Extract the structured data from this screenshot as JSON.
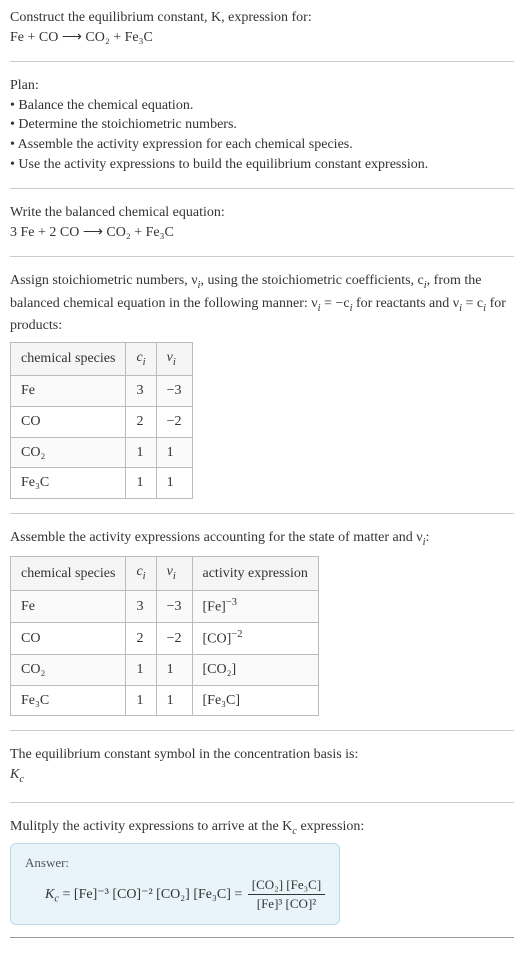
{
  "intro": {
    "line1": "Construct the equilibrium constant, K, expression for:",
    "equation": "Fe + CO ⟶ CO₂ + Fe₃C"
  },
  "plan": {
    "heading": "Plan:",
    "items": [
      "Balance the chemical equation.",
      "Determine the stoichiometric numbers.",
      "Assemble the activity expression for each chemical species.",
      "Use the activity expressions to build the equilibrium constant expression."
    ]
  },
  "balanced": {
    "heading": "Write the balanced chemical equation:",
    "equation": "3 Fe + 2 CO ⟶ CO₂ + Fe₃C"
  },
  "assign": {
    "text1": "Assign stoichiometric numbers, ν",
    "text2": ", using the stoichiometric coefficients, c",
    "text3": ", from the balanced chemical equation in the following manner: ν",
    "text4": " = −c",
    "text5": " for reactants and ν",
    "text6": " = c",
    "text7": " for products:"
  },
  "table1": {
    "headers": [
      "chemical species",
      "cᵢ",
      "νᵢ"
    ],
    "rows": [
      {
        "species": "Fe",
        "c": "3",
        "nu": "−3"
      },
      {
        "species": "CO",
        "c": "2",
        "nu": "−2"
      },
      {
        "species": "CO₂",
        "c": "1",
        "nu": "1"
      },
      {
        "species": "Fe₃C",
        "c": "1",
        "nu": "1"
      }
    ]
  },
  "assemble": {
    "text1": "Assemble the activity expressions accounting for the state of matter and ν",
    "text2": ":"
  },
  "table2": {
    "headers": [
      "chemical species",
      "cᵢ",
      "νᵢ",
      "activity expression"
    ],
    "rows": [
      {
        "species": "Fe",
        "c": "3",
        "nu": "−3",
        "expr_base": "[Fe]",
        "expr_sup": "−3"
      },
      {
        "species": "CO",
        "c": "2",
        "nu": "−2",
        "expr_base": "[CO]",
        "expr_sup": "−2"
      },
      {
        "species": "CO₂",
        "c": "1",
        "nu": "1",
        "expr_base": "[CO₂]",
        "expr_sup": ""
      },
      {
        "species": "Fe₃C",
        "c": "1",
        "nu": "1",
        "expr_base": "[Fe₃C]",
        "expr_sup": ""
      }
    ]
  },
  "symbol": {
    "text": "The equilibrium constant symbol in the concentration basis is:",
    "kc": "K",
    "kc_sub": "c"
  },
  "multiply": {
    "text1": "Mulitply the activity expressions to arrive at the K",
    "text1b": " expression:"
  },
  "answer": {
    "label": "Answer:",
    "kc": "K",
    "kc_sub": "c",
    "eq_part": " = [Fe]⁻³ [CO]⁻² [CO₂] [Fe₃C] = ",
    "num": "[CO₂] [Fe₃C]",
    "den": "[Fe]³ [CO]²"
  },
  "chart_data": {
    "type": "table",
    "tables": [
      {
        "title": "Stoichiometric coefficients and numbers",
        "columns": [
          "chemical species",
          "c_i",
          "nu_i"
        ],
        "rows": [
          [
            "Fe",
            3,
            -3
          ],
          [
            "CO",
            2,
            -2
          ],
          [
            "CO2",
            1,
            1
          ],
          [
            "Fe3C",
            1,
            1
          ]
        ]
      },
      {
        "title": "Activity expressions",
        "columns": [
          "chemical species",
          "c_i",
          "nu_i",
          "activity expression"
        ],
        "rows": [
          [
            "Fe",
            3,
            -3,
            "[Fe]^-3"
          ],
          [
            "CO",
            2,
            -2,
            "[CO]^-2"
          ],
          [
            "CO2",
            1,
            1,
            "[CO2]"
          ],
          [
            "Fe3C",
            1,
            1,
            "[Fe3C]"
          ]
        ]
      }
    ]
  }
}
